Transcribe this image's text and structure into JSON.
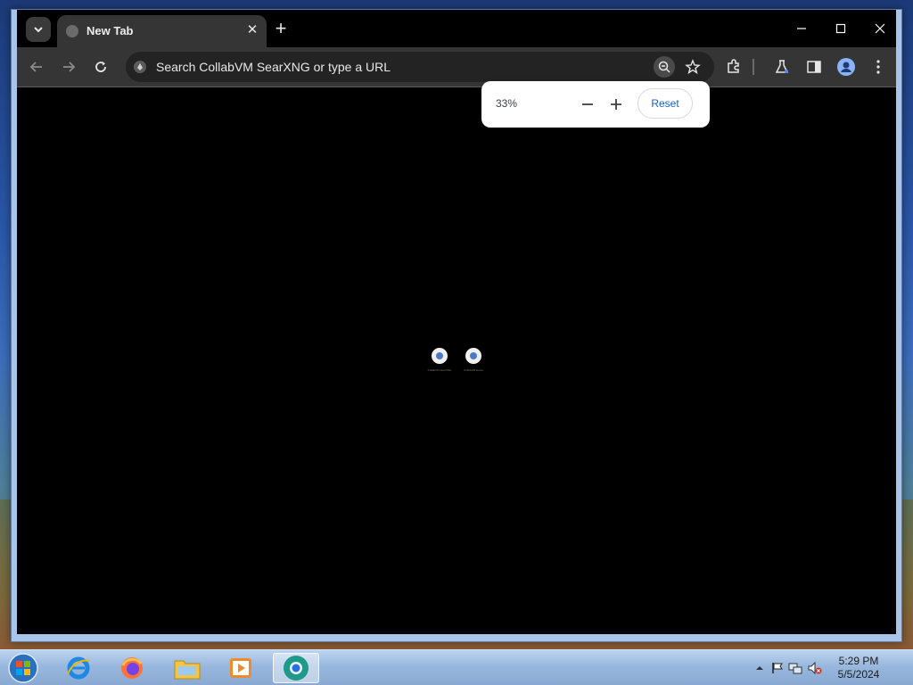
{
  "browser": {
    "tab": {
      "title": "New Tab"
    },
    "omnibox": {
      "placeholder": "Search CollabVM SearXNG or type a URL"
    },
    "zoom_bubble": {
      "level": "33%",
      "reset_label": "Reset"
    },
    "shortcuts": [
      {
        "label": "CollabVM SearXNG"
      },
      {
        "label": "CollabVM Home"
      }
    ]
  },
  "taskbar": {
    "icons": [
      "start-orb-icon",
      "internet-explorer-icon",
      "firefox-icon",
      "file-explorer-icon",
      "media-player-icon",
      "chromium-browser-icon"
    ],
    "tray_icons": [
      "chevron-up-icon",
      "action-center-flag-icon",
      "network-icon",
      "speaker-muted-icon"
    ],
    "clock": {
      "time": "5:29 PM",
      "date": "5/5/2024"
    }
  },
  "colors": {
    "accent_blue": "#1a62c9",
    "page_bg": "#000000",
    "tab_bg": "#353535"
  }
}
